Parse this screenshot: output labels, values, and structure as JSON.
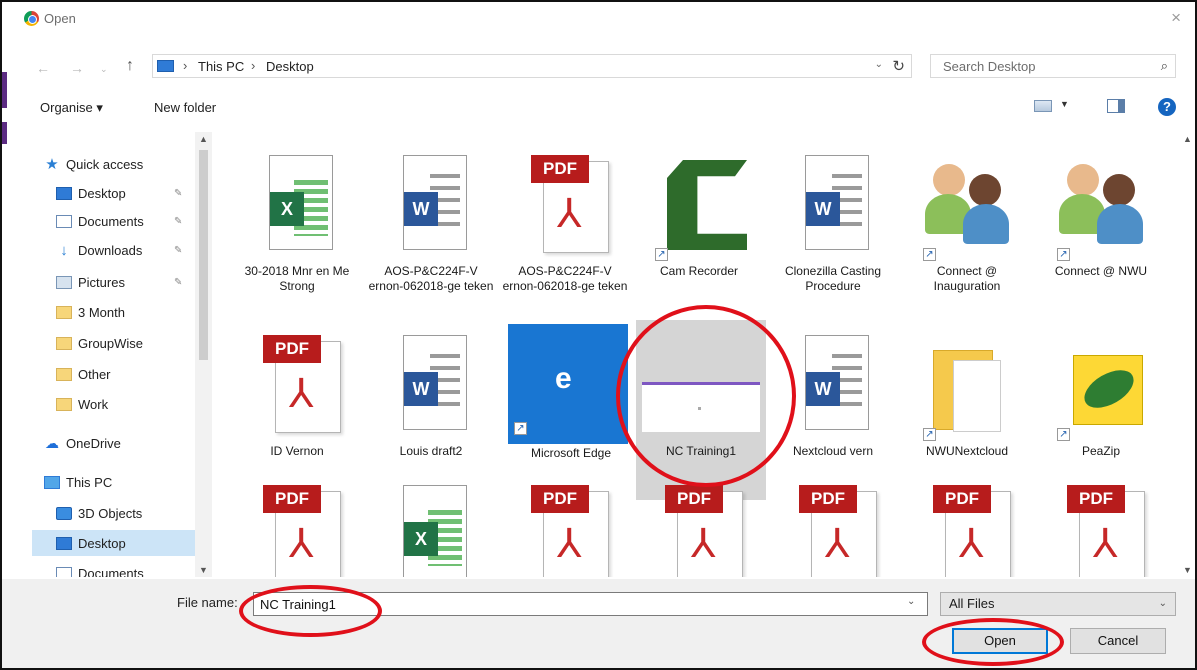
{
  "window": {
    "title": "Open",
    "close_glyph": "×",
    "app_icon": "chrome-icon"
  },
  "address": {
    "crumbs": [
      "This PC",
      "Desktop"
    ],
    "search_placeholder": "Search Desktop"
  },
  "commandbar": {
    "organise_label": "Organise ▾",
    "new_folder_label": "New folder"
  },
  "nav": {
    "items": [
      {
        "label": "Quick access",
        "icon": "star-icon"
      },
      {
        "label": "Desktop",
        "icon": "desktop-icon",
        "pinned": true
      },
      {
        "label": "Documents",
        "icon": "documents-icon",
        "pinned": true
      },
      {
        "label": "Downloads",
        "icon": "download-icon",
        "pinned": true
      },
      {
        "label": "Pictures",
        "icon": "pictures-icon",
        "pinned": true
      },
      {
        "label": "3 Month",
        "icon": "folder-icon"
      },
      {
        "label": "GroupWise",
        "icon": "folder-icon"
      },
      {
        "label": "Other",
        "icon": "folder-icon"
      },
      {
        "label": "Work",
        "icon": "folder-icon"
      },
      {
        "label": "OneDrive",
        "icon": "cloud-icon"
      },
      {
        "label": "This PC",
        "icon": "pc-icon"
      },
      {
        "label": "3D Objects",
        "icon": "objects-3d-icon"
      },
      {
        "label": "Desktop",
        "icon": "desktop-icon",
        "selected": true
      },
      {
        "label": "Documents",
        "icon": "documents-icon"
      }
    ]
  },
  "files": {
    "row1": [
      {
        "label": "30-2018 Mnr en Me Strong",
        "type": "excel"
      },
      {
        "label": "AOS-P&C224F-V ernon-062018-ge teken",
        "type": "word"
      },
      {
        "label": "AOS-P&C224F-V ernon-062018-ge teken",
        "type": "pdf"
      },
      {
        "label": "Cam Recorder",
        "type": "camtasia"
      },
      {
        "label": "Clonezilla Casting Procedure",
        "type": "word"
      },
      {
        "label": "Connect @ Inauguration",
        "type": "contacts"
      },
      {
        "label": "Connect @ NWU",
        "type": "contacts"
      }
    ],
    "row2": [
      {
        "label": "ID Vernon",
        "type": "pdf"
      },
      {
        "label": "Louis draft2",
        "type": "word"
      },
      {
        "label": "Microsoft Edge",
        "type": "edge"
      },
      {
        "label": "NC Training1",
        "type": "preview",
        "selected": true
      },
      {
        "label": "Nextcloud vern",
        "type": "word"
      },
      {
        "label": "NWUNextcloud",
        "type": "folder"
      },
      {
        "label": "PeaZip",
        "type": "peazip"
      }
    ],
    "row3": [
      {
        "type": "pdf"
      },
      {
        "type": "excel"
      },
      {
        "type": "pdf"
      },
      {
        "type": "pdf"
      },
      {
        "type": "pdf"
      },
      {
        "type": "pdf"
      },
      {
        "type": "pdf"
      }
    ],
    "pdf_tag": "PDF",
    "word_letter": "W",
    "excel_letter": "X",
    "edge_letter": "e"
  },
  "footer": {
    "file_name_label": "File name:",
    "file_name_value": "NC Training1",
    "file_type_value": "All Files",
    "open_label": "Open",
    "cancel_label": "Cancel"
  },
  "colors": {
    "highlight_ring": "#e0101a",
    "selection": "#cce4f7",
    "pdf_red": "#b71c1c",
    "word_blue": "#2b579a",
    "excel_green": "#217346"
  }
}
